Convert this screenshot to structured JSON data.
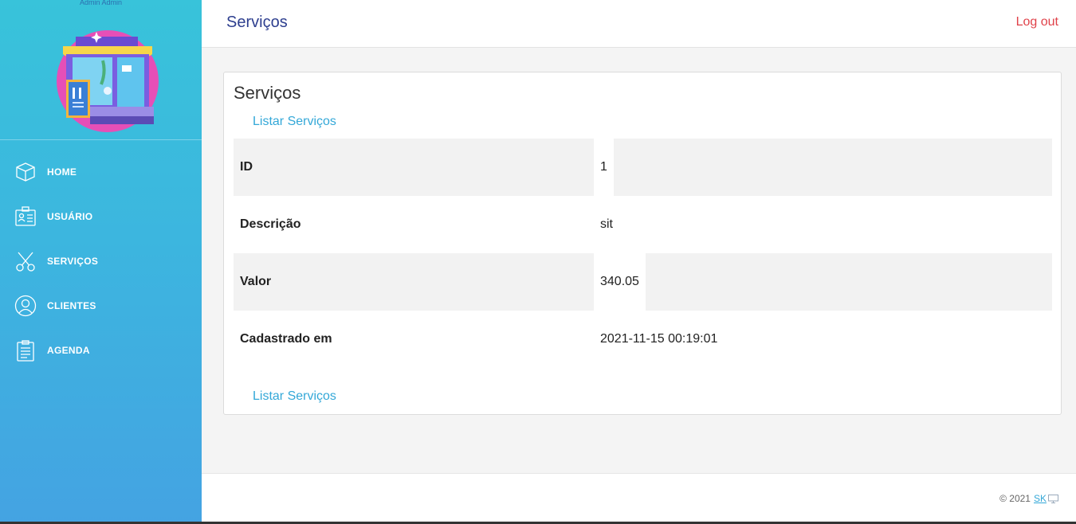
{
  "sidebar": {
    "user_name": "Admin Admin",
    "items": [
      {
        "label": "HOME",
        "icon": "box-icon"
      },
      {
        "label": "USUÁRIO",
        "icon": "id-card-icon"
      },
      {
        "label": "SERVIÇOS",
        "icon": "scissors-icon"
      },
      {
        "label": "CLIENTES",
        "icon": "user-circle-icon"
      },
      {
        "label": "AGENDA",
        "icon": "clipboard-icon"
      }
    ]
  },
  "header": {
    "title": "Serviços",
    "logout_label": "Log out"
  },
  "card": {
    "title": "Serviços",
    "list_link_top": "Listar Serviços",
    "list_link_bottom": "Listar Serviços",
    "rows": [
      {
        "key": "ID",
        "value": "1"
      },
      {
        "key": "Descrição",
        "value": "sit"
      },
      {
        "key": "Valor",
        "value": "340.05"
      },
      {
        "key": "Cadastrado em",
        "value": "2021-11-15 00:19:01"
      }
    ]
  },
  "footer": {
    "copyright": "© 2021",
    "brand": "SK"
  },
  "colors": {
    "accent": "#34a8d8",
    "logout": "#e0424a",
    "title": "#2e3f8f",
    "sidebar_top": "#38c3da",
    "sidebar_bottom": "#44a3e2"
  }
}
